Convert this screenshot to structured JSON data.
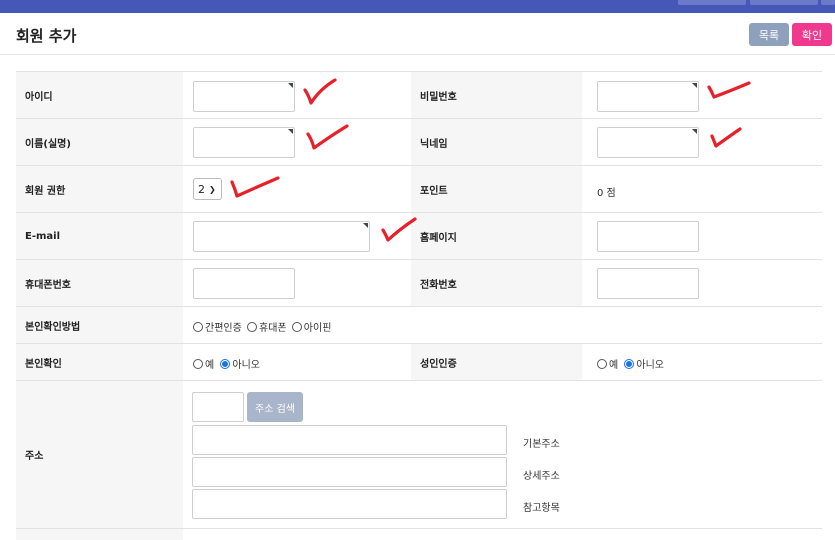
{
  "title": "회원 추가",
  "buttons": {
    "list": "목록",
    "confirm": "확인"
  },
  "fields": {
    "id": {
      "label": "아이디",
      "value": ""
    },
    "password": {
      "label": "비밀번호",
      "value": ""
    },
    "name": {
      "label": "이름(실명)",
      "value": ""
    },
    "nickname": {
      "label": "닉네임",
      "value": ""
    },
    "level": {
      "label": "회원 권한",
      "value": "2"
    },
    "point": {
      "label": "포인트",
      "value": "0 점"
    },
    "email": {
      "label": "E-mail",
      "value": ""
    },
    "homepage": {
      "label": "홈페이지",
      "value": ""
    },
    "mobile": {
      "label": "휴대폰번호",
      "value": ""
    },
    "phone": {
      "label": "전화번호",
      "value": ""
    },
    "cert_type": {
      "label": "본인확인방법",
      "options": [
        "간편인증",
        "휴대폰",
        "아이핀"
      ]
    },
    "certified": {
      "label": "본인확인",
      "options": [
        "예",
        "아니오"
      ],
      "selected": "아니오"
    },
    "adult": {
      "label": "성인인증",
      "options": [
        "예",
        "아니오"
      ],
      "selected": "아니오"
    },
    "address": {
      "label": "주소",
      "search": "주소 검색",
      "basic": "기본주소",
      "detail": "상세주소",
      "extra": "참고항목"
    }
  },
  "annotation_color": "#e8202a"
}
